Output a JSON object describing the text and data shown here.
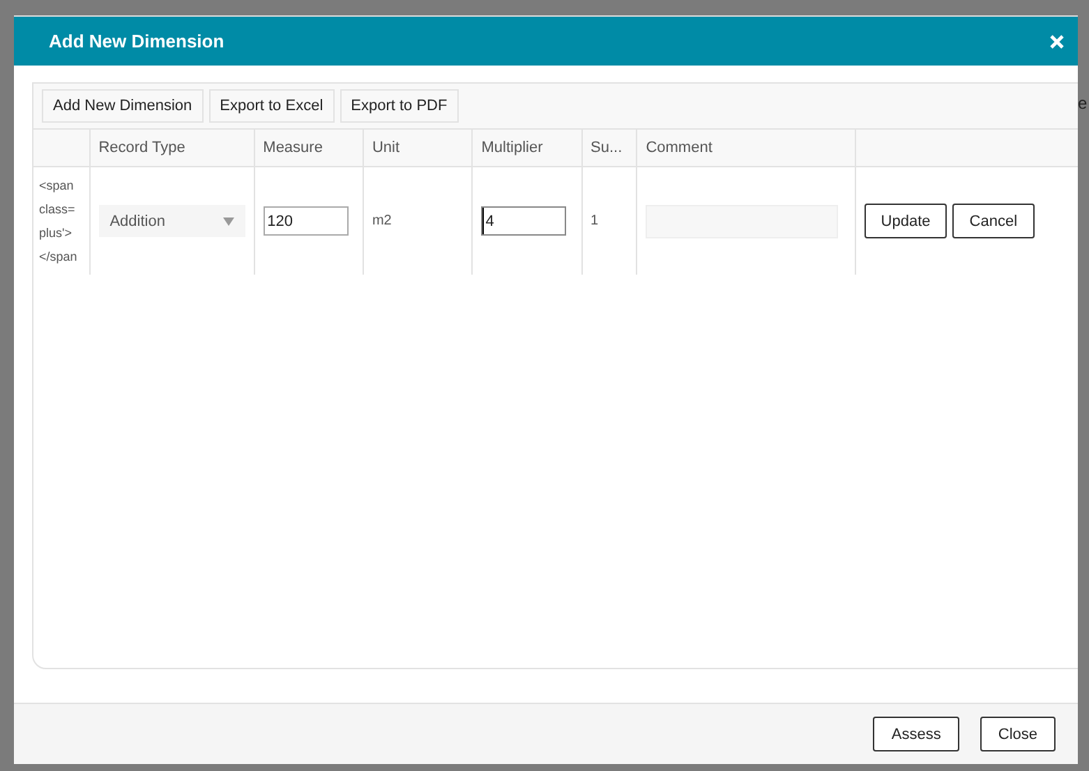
{
  "background": {
    "texts": [
      "e"
    ]
  },
  "window": {
    "title": "Add New Dimension"
  },
  "toolbar": {
    "buttons": [
      "Add New Dimension",
      "Export to Excel",
      "Export to PDF"
    ]
  },
  "table": {
    "columns": [
      "",
      "Record Type",
      "Measure",
      "Unit",
      "Multiplier",
      "Su...",
      "Comment",
      ""
    ],
    "rows": [
      {
        "cells": [
          {
            "kind": "text",
            "text": "<span class= plus'> </span"
          },
          {
            "kind": "select",
            "value": "Addition"
          },
          {
            "kind": "input",
            "value": "120",
            "focused": false
          },
          {
            "kind": "text",
            "text": "m2"
          },
          {
            "kind": "input",
            "value": "4",
            "focused": true
          },
          {
            "kind": "text",
            "text": "1"
          },
          {
            "kind": "comment"
          },
          {
            "kind": "actions",
            "buttons": [
              "Update",
              "Cancel"
            ]
          }
        ]
      }
    ]
  },
  "footer": {
    "buttons": [
      "Assess",
      "Close"
    ]
  }
}
